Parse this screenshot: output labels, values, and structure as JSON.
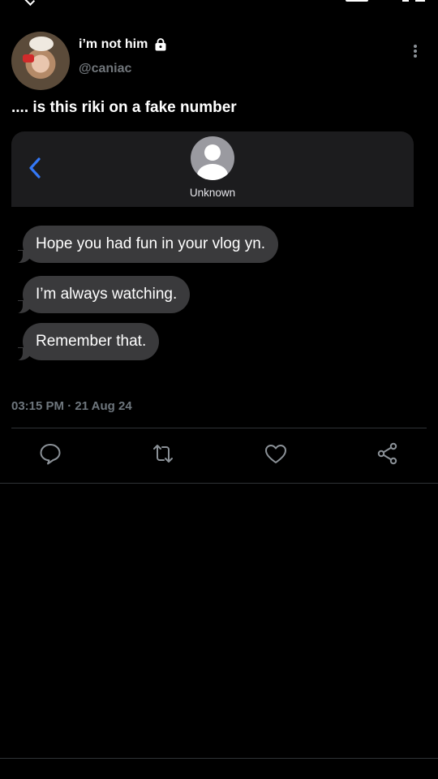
{
  "post": {
    "display_name": "i’m not him",
    "handle": "@caniac",
    "text": ".... is this riki on a fake number",
    "timestamp": "03:15 PM · 21 Aug 24"
  },
  "embedded_screenshot": {
    "contact_name": "Unknown",
    "messages": [
      "Hope you had fun in your vlog yn.",
      "I’m always watching.",
      "Remember that."
    ],
    "bubble_color": "#3a3a3c",
    "back_arrow_color": "#3478f6"
  },
  "actions": [
    "reply-icon",
    "retweet-icon",
    "like-icon",
    "share-icon"
  ],
  "colors": {
    "background": "#000000",
    "secondary_text": "#71767b",
    "divider": "#2f3336"
  }
}
